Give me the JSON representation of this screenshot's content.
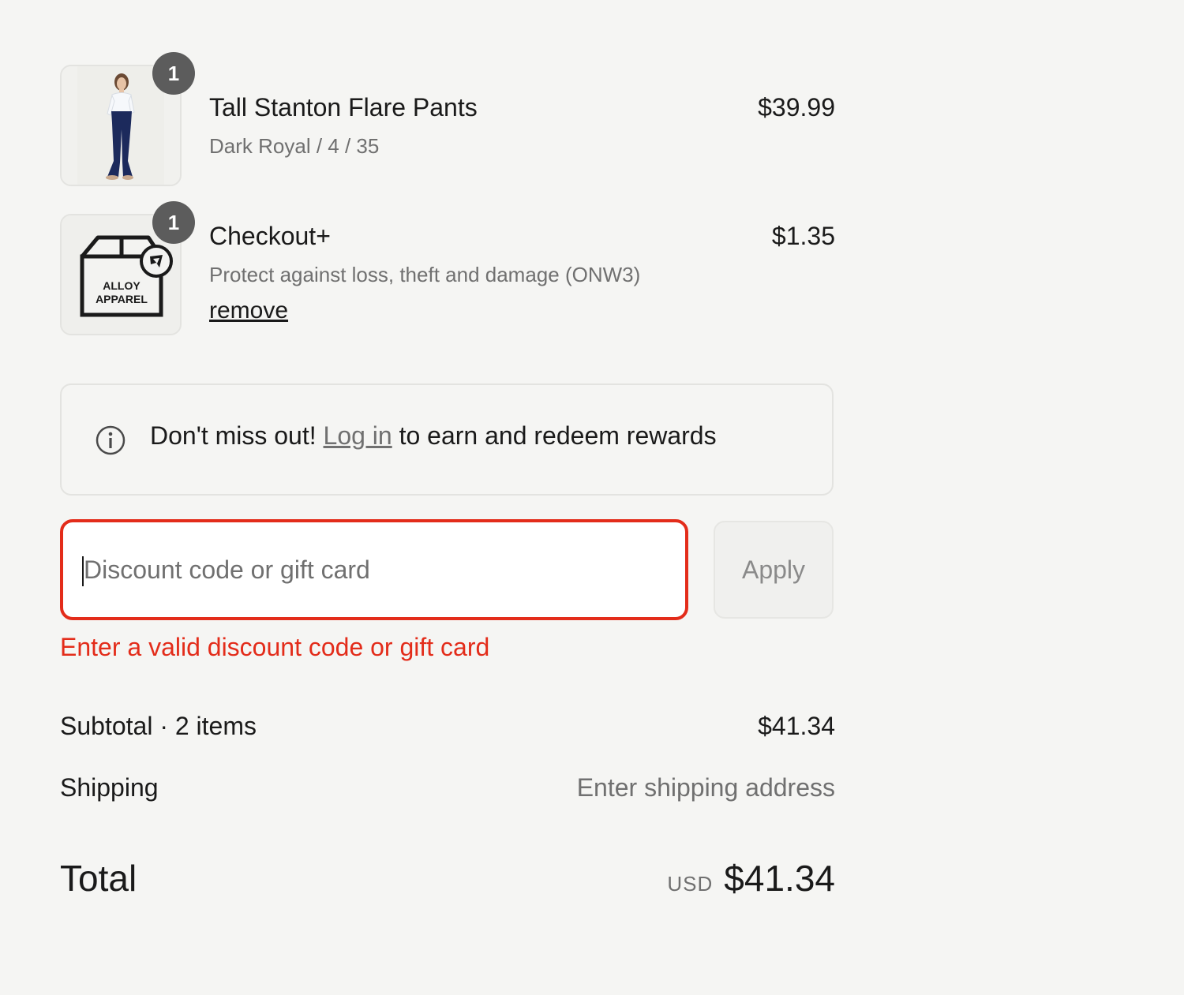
{
  "line_items": [
    {
      "quantity": "1",
      "title": "Tall Stanton Flare Pants",
      "variant": "Dark Royal / 4 / 35",
      "price": "$39.99",
      "image_icon": "flare-pants-model-thumbnail"
    },
    {
      "quantity": "1",
      "title": "Checkout+",
      "description": "Protect against loss, theft and damage (ONW3)",
      "price": "$1.35",
      "remove_label": "remove",
      "image_icon": "alloy-apparel-package-icon",
      "logo_text": [
        "ALLOY",
        "APPAREL"
      ]
    }
  ],
  "rewards": {
    "prefix": "Don't miss out! ",
    "link_label": "Log in",
    "suffix": " to earn and redeem rewards",
    "icon": "info-icon"
  },
  "discount": {
    "placeholder": "Discount code or gift card",
    "value": "",
    "apply_label": "Apply",
    "error": "Enter a valid discount code or gift card"
  },
  "summary": {
    "subtotal_label": "Subtotal · 2 items",
    "subtotal_value": "$41.34",
    "shipping_label": "Shipping",
    "shipping_value": "Enter shipping address",
    "total_label": "Total",
    "currency": "USD",
    "total_value": "$41.34"
  },
  "colors": {
    "error": "#e32c1a",
    "background": "#f5f5f3",
    "badge": "#5c5c5c",
    "muted_text": "#707070"
  }
}
